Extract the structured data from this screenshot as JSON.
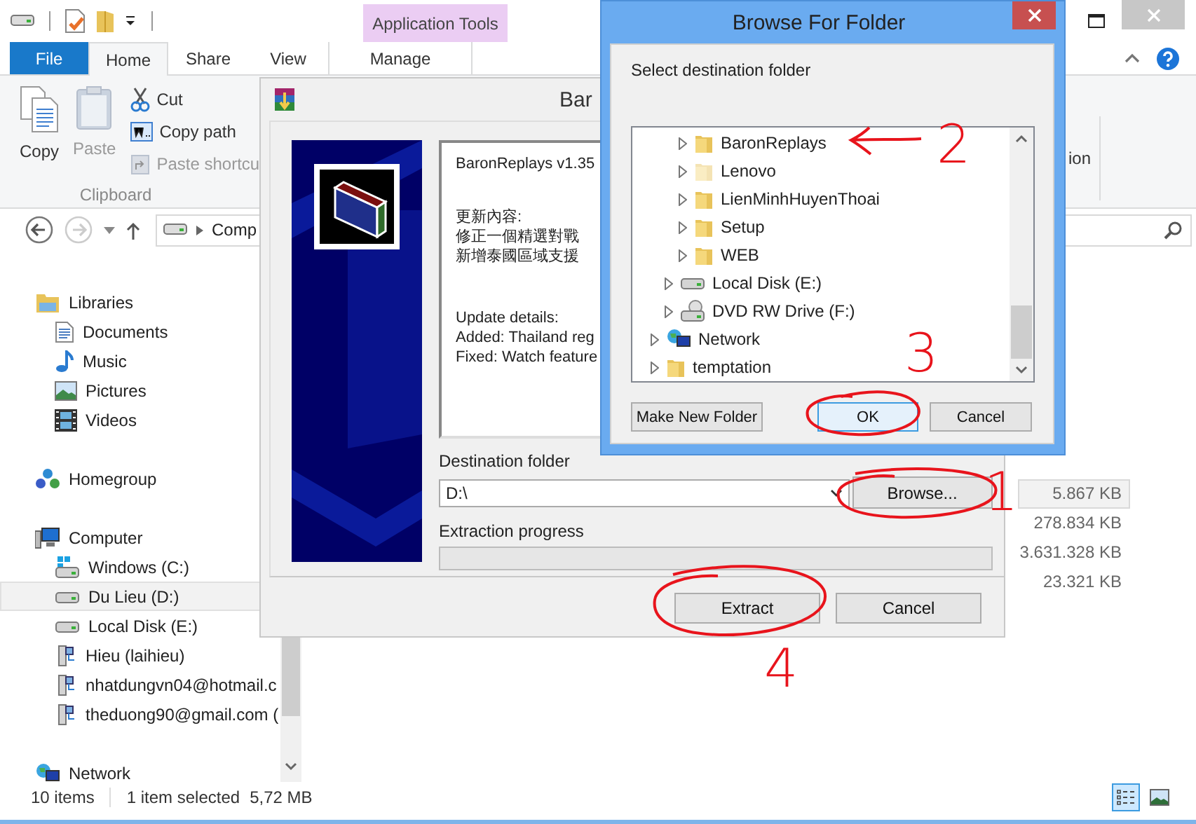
{
  "explorer": {
    "context_tab_group": "Application Tools",
    "ribbon_tabs": [
      {
        "label": "File",
        "kind": "file",
        "selected": false
      },
      {
        "label": "Home",
        "kind": "tab",
        "selected": true
      },
      {
        "label": "Share",
        "kind": "tab",
        "selected": false
      },
      {
        "label": "View",
        "kind": "tab",
        "selected": false
      },
      {
        "label": "Manage",
        "kind": "context",
        "selected": false
      }
    ],
    "clipboard": {
      "large_buttons": [
        {
          "label": "Copy",
          "kind": "copy",
          "disabled": false
        },
        {
          "label": "Paste",
          "kind": "paste",
          "disabled": true
        }
      ],
      "small_buttons": [
        {
          "label": "Cut",
          "kind": "cut",
          "disabled": false
        },
        {
          "label": "Copy path",
          "kind": "copy-path",
          "disabled": false
        },
        {
          "label": "Paste shortcu",
          "kind": "paste-shortcut",
          "disabled": true
        }
      ],
      "group_label": "Clipboard"
    },
    "ribbon_fragment": "ion",
    "address_segment": "Comp",
    "nav_pane": [
      {
        "label": "Libraries",
        "kind": "libraries",
        "selected": false,
        "children": [
          {
            "label": "Documents",
            "kind": "documents",
            "selected": false
          },
          {
            "label": "Music",
            "kind": "music",
            "selected": false
          },
          {
            "label": "Pictures",
            "kind": "pictures",
            "selected": false
          },
          {
            "label": "Videos",
            "kind": "videos",
            "selected": false
          }
        ]
      },
      {
        "label": "Homegroup",
        "kind": "homegroup",
        "selected": false
      },
      {
        "label": "Computer",
        "kind": "computer",
        "selected": false,
        "children": [
          {
            "label": "Windows (C:)",
            "kind": "windows-drive",
            "selected": false
          },
          {
            "label": "Du Lieu (D:)",
            "kind": "drive",
            "selected": true
          },
          {
            "label": "Local Disk (E:)",
            "kind": "drive",
            "selected": false
          },
          {
            "label": "Hieu (laihieu)",
            "kind": "user-drive",
            "selected": false
          },
          {
            "label": "nhatdungvn04@hotmail.c",
            "kind": "user-drive",
            "selected": false
          },
          {
            "label": "theduong90@gmail.com (",
            "kind": "user-drive",
            "selected": false
          }
        ]
      },
      {
        "label": "Network",
        "kind": "network",
        "selected": false
      }
    ],
    "file_sizes": [
      {
        "size": "5.867 KB",
        "selected": true
      },
      {
        "size": "278.834 KB",
        "selected": false
      },
      {
        "size": "3.631.328 KB",
        "selected": false
      },
      {
        "size": "23.321 KB",
        "selected": false
      }
    ],
    "status": {
      "item_count": "10 items",
      "selection": "1 item selected",
      "selection_size": "5,72 MB"
    },
    "views": [
      {
        "kind": "details",
        "selected": true
      },
      {
        "kind": "large-icons",
        "selected": false
      }
    ]
  },
  "extractor_dialog": {
    "title": "Bar",
    "notes": [
      [
        "BaronReplays v1.35"
      ],
      [
        "更新內容:",
        "修正一個精選對戰",
        "新增泰國區域支援"
      ],
      [
        "Update details:",
        "Added: Thailand reg",
        "Fixed: Watch feature"
      ]
    ],
    "destination_label": "Destination folder",
    "destination_value": "D:\\",
    "browse_button": "Browse...",
    "progress_label": "Extraction progress",
    "progress": {
      "level": 0
    },
    "buttons": [
      "Extract",
      "Cancel"
    ]
  },
  "browse_dialog": {
    "title": "Browse For Folder",
    "prompt": "Select destination folder",
    "tree": [
      {
        "children": [
          {
            "children": [
              {
                "label": "BaronReplays",
                "kind": "folder",
                "hidden": false
              },
              {
                "label": "Lenovo",
                "kind": "folder",
                "hidden": true
              },
              {
                "label": "LienMinhHuyenThoai",
                "kind": "folder",
                "hidden": false
              },
              {
                "label": "Setup",
                "kind": "folder",
                "hidden": false
              },
              {
                "label": "WEB",
                "kind": "folder",
                "hidden": false
              }
            ]
          },
          {
            "label": "Local Disk (E:)",
            "kind": "drive"
          },
          {
            "label": "DVD RW Drive (F:)",
            "kind": "dvd"
          }
        ]
      },
      {
        "label": "Network",
        "kind": "network"
      },
      {
        "label": "temptation",
        "kind": "folder",
        "hidden": false
      }
    ],
    "buttons": [
      {
        "label": "Make New Folder",
        "default": false
      },
      {
        "label": "OK",
        "default": true
      },
      {
        "label": "Cancel",
        "default": false
      }
    ]
  },
  "annotations": [
    "2",
    "3",
    "1",
    "4"
  ]
}
